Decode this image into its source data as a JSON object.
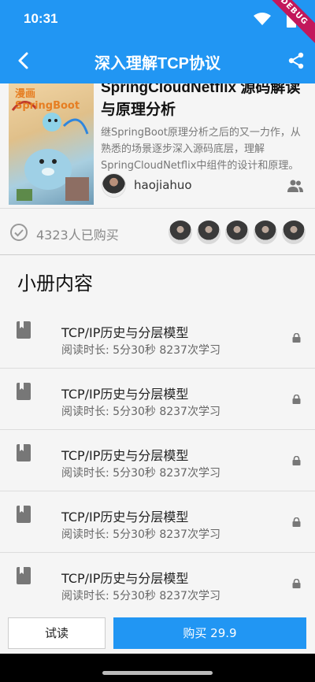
{
  "status_bar": {
    "time": "10:31",
    "debug_banner": "DEBUG"
  },
  "appbar": {
    "title": "深入理解TCP协议",
    "back_icon": "back-arrow-icon",
    "share_icon": "share-icon"
  },
  "book": {
    "cover_text": "漫画SpringBoot",
    "title": "SpringCloudNetflix 源码解读与原理分析",
    "description": "继SpringBoot原理分析之后的又一力作，从熟悉的场景逐步深入源码底层，理解SpringCloudNetflix中组件的设计和原理。",
    "author": "haojiahuo"
  },
  "buyers": {
    "text": "4323人已购买"
  },
  "section": {
    "title": "小册内容"
  },
  "chapters": [
    {
      "title": "TCP/IP历史与分层模型",
      "meta": "阅读时长: 5分30秒  8237次学习"
    },
    {
      "title": "TCP/IP历史与分层模型",
      "meta": "阅读时长: 5分30秒  8237次学习"
    },
    {
      "title": "TCP/IP历史与分层模型",
      "meta": "阅读时长: 5分30秒  8237次学习"
    },
    {
      "title": "TCP/IP历史与分层模型",
      "meta": "阅读时长: 5分30秒  8237次学习"
    },
    {
      "title": "TCP/IP历史与分层模型",
      "meta": "阅读时长: 5分30秒  8237次学习"
    }
  ],
  "bottom": {
    "trial_label": "试读",
    "buy_label": "购买 29.9"
  },
  "colors": {
    "primary": "#2196f3",
    "debug": "#c2185b"
  }
}
